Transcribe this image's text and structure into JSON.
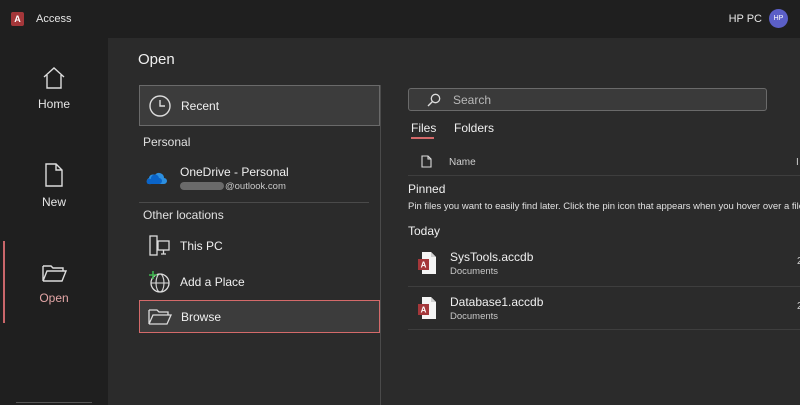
{
  "titlebar": {
    "app_title": "Access",
    "logo_letter": "A",
    "user_name": "HP PC",
    "avatar_initials": "HP"
  },
  "nav": {
    "items": [
      {
        "label": "Home",
        "icon": "home-icon"
      },
      {
        "label": "New",
        "icon": "new-document-icon"
      },
      {
        "label": "Open",
        "icon": "open-folder-icon",
        "active": true
      }
    ]
  },
  "page_title": "Open",
  "locations": {
    "recent_label": "Recent",
    "personal_header": "Personal",
    "onedrive_name": "OneDrive - Personal",
    "onedrive_email_suffix": "@outlook.com",
    "other_header": "Other locations",
    "this_pc_label": "This PC",
    "add_place_label": "Add a Place",
    "browse_label": "Browse"
  },
  "search": {
    "placeholder": "Search"
  },
  "tabs": {
    "files": "Files",
    "folders": "Folders"
  },
  "columns": {
    "name": "Name",
    "more": "I"
  },
  "pinned": {
    "header": "Pinned",
    "description": "Pin files you want to easily find later. Click the pin icon that appears when you hover over a file."
  },
  "today": {
    "header": "Today",
    "files": [
      {
        "name": "SysTools.accdb",
        "location": "Documents",
        "date_clip": "2"
      },
      {
        "name": "Database1.accdb",
        "location": "Documents",
        "date_clip": "2"
      }
    ]
  },
  "colors": {
    "accent": "#d46a6a",
    "access_brand": "#a4373a",
    "background": "#2b2b2b",
    "nav_background": "#1f1f1f"
  }
}
